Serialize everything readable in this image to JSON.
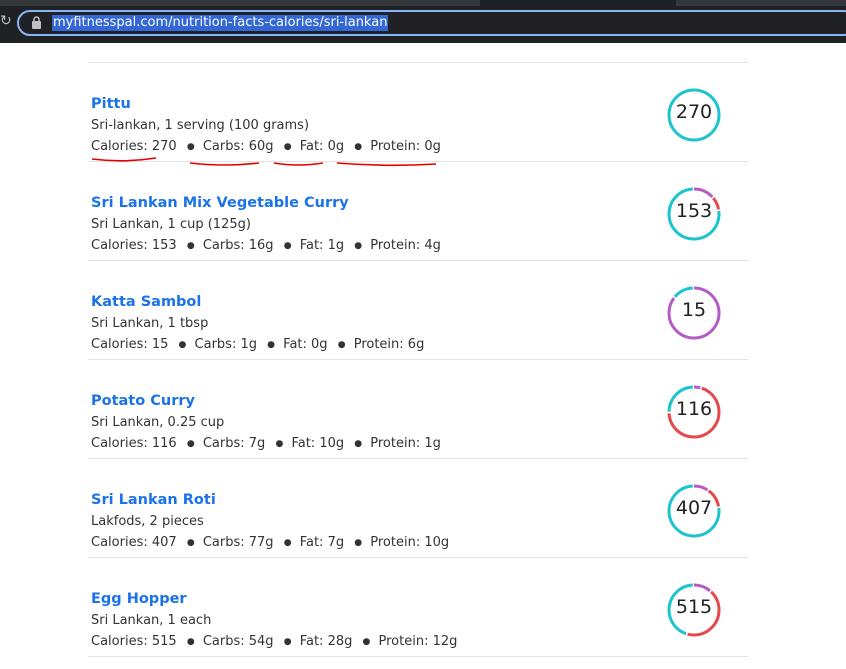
{
  "browser": {
    "url": "myfitnesspal.com/nutrition-facts-calories/sri-lankan"
  },
  "colors": {
    "carbs": "#1bc4cf",
    "fat": "#b55bc5",
    "protein": "#e8474c",
    "annotation": "#e60000"
  },
  "labels": {
    "calories": "Calories:",
    "carbs": "Carbs:",
    "fat": "Fat:",
    "protein": "Protein:"
  },
  "foods": [
    {
      "name": "Pittu",
      "serving": "Sri-lankan, 1 serving (100 grams)",
      "calories": "270",
      "carbs": "60g",
      "fat": "0g",
      "protein": "0g",
      "split": {
        "carbs": 1.0,
        "fat": 0.0,
        "protein": 0.0
      }
    },
    {
      "name": "Sri Lankan Mix Vegetable Curry",
      "serving": "Sri Lankan, 1 cup (125g)",
      "calories": "153",
      "carbs": "16g",
      "fat": "1g",
      "protein": "4g",
      "split": {
        "carbs": 0.77,
        "fat": 0.14,
        "protein": 0.09
      }
    },
    {
      "name": "Katta Sambol",
      "serving": "Sri Lankan, 1 tbsp",
      "calories": "15",
      "carbs": "1g",
      "fat": "0g",
      "protein": "6g",
      "split": {
        "carbs": 0.14,
        "fat": 0.86,
        "protein": 0.0
      }
    },
    {
      "name": "Potato Curry",
      "serving": "Sri Lankan, 0.25 cup",
      "calories": "116",
      "carbs": "7g",
      "fat": "10g",
      "protein": "1g",
      "split": {
        "carbs": 0.25,
        "fat": 0.05,
        "protein": 0.7
      }
    },
    {
      "name": "Sri Lankan Roti",
      "serving": "Lakfods, 2 pieces",
      "calories": "407",
      "carbs": "77g",
      "fat": "7g",
      "protein": "10g",
      "split": {
        "carbs": 0.77,
        "fat": 0.1,
        "protein": 0.13
      }
    },
    {
      "name": "Egg Hopper",
      "serving": "Sri Lankan, 1 each",
      "calories": "515",
      "carbs": "54g",
      "fat": "28g",
      "protein": "12g",
      "split": {
        "carbs": 0.45,
        "fat": 0.12,
        "protein": 0.43
      }
    }
  ]
}
